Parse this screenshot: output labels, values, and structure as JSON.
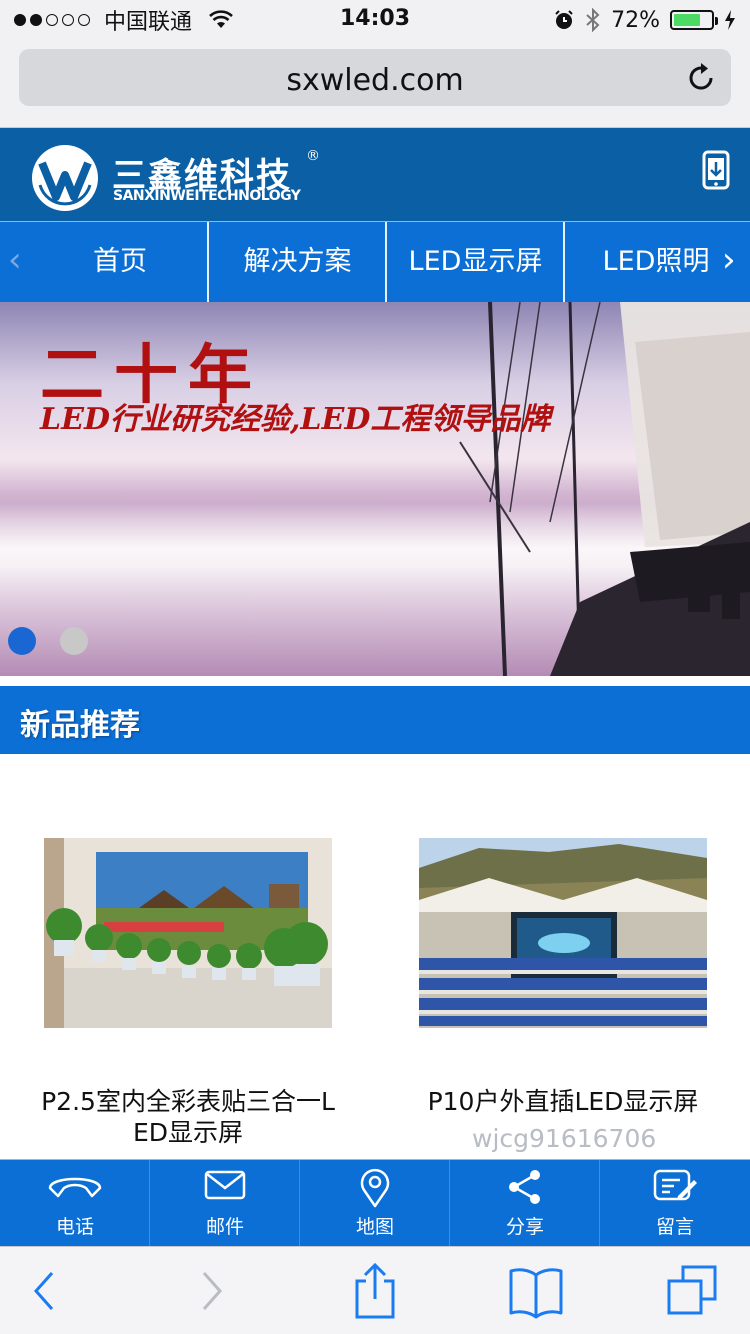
{
  "status_bar": {
    "carrier": "中国联通",
    "time": "14:03",
    "battery": "72%",
    "battery_level": 0.72
  },
  "browser": {
    "url": "sxwled.com"
  },
  "header": {
    "logo_cn": "三鑫维科技",
    "logo_registered": "®",
    "logo_en": "SANXINWEITECHNOLOGY"
  },
  "nav": {
    "items": [
      {
        "label": "首页"
      },
      {
        "label": "解决方案"
      },
      {
        "label": "LED显示屏"
      },
      {
        "label": "LED照明"
      }
    ]
  },
  "banner": {
    "title": "二十年",
    "subtitle": "LED行业研究经验,LED工程领导品牌",
    "active_slide": 1,
    "slide_count": 2
  },
  "section": {
    "title": "新品推荐"
  },
  "products": [
    {
      "name_line1": "P2.5室内全彩表贴三合一L",
      "name_line2": "ED显示屏"
    },
    {
      "name_line1": "P10户外直插LED显示屏",
      "name_line2": ""
    }
  ],
  "watermark": "wjcg91616706",
  "tabbar": {
    "items": [
      {
        "label": "电话"
      },
      {
        "label": "邮件"
      },
      {
        "label": "地图"
      },
      {
        "label": "分享"
      },
      {
        "label": "留言"
      }
    ]
  },
  "colors": {
    "header_blue": "#0b5fa4",
    "nav_blue": "#0b6fd6",
    "indicator_active": "#1a66d2",
    "indicator_inactive": "#c8c8c8"
  }
}
